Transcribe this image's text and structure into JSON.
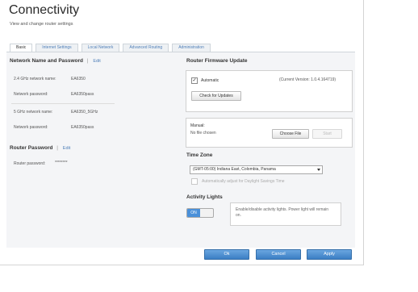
{
  "page": {
    "title": "Connectivity",
    "subtitle": "View and change router settings"
  },
  "tabs": [
    "Basic",
    "Internet Settings",
    "Local Network",
    "Advanced Routing",
    "Administration"
  ],
  "network": {
    "heading": "Network Name and Password",
    "edit_label": "Edit",
    "rows": [
      {
        "label": "2.4 GHz network name:",
        "value": "EA6350"
      },
      {
        "label": "Network password:",
        "value": "EA6350pass"
      },
      {
        "label": "5 GHz network name:",
        "value": "EA6350_5GHz"
      },
      {
        "label": "Network password:",
        "value": "EA6350pass"
      }
    ]
  },
  "router_password": {
    "heading": "Router Password",
    "edit_label": "Edit",
    "label": "Router password:",
    "value": "********"
  },
  "firmware": {
    "heading": "Router Firmware Update",
    "automatic_label": "Automatic",
    "automatic_checked": true,
    "current_version": "(Current Version: 1.0.4.164719)",
    "check_button": "Check for Updates",
    "manual_label": "Manual:",
    "no_file": "No file chosen",
    "choose_file_button": "Choose File",
    "start_button": "Start"
  },
  "timezone": {
    "heading": "Time Zone",
    "selected": "(GMT-05:00) Indiana East, Colombia, Panama",
    "dst_label": "Automatically adjust for Daylight Savings Time",
    "dst_checked": false
  },
  "activity": {
    "heading": "Activity Lights",
    "toggle_label": "ON",
    "toggle_state": "on",
    "help": "Enable/disable activity lights. Power light will remain on."
  },
  "footer": {
    "ok": "Ok",
    "cancel": "Cancel",
    "apply": "Apply"
  },
  "colors": {
    "accent": "#4f7fb8",
    "primary_button": "#3b7ec4",
    "toggle_on": "#4a90d9"
  }
}
